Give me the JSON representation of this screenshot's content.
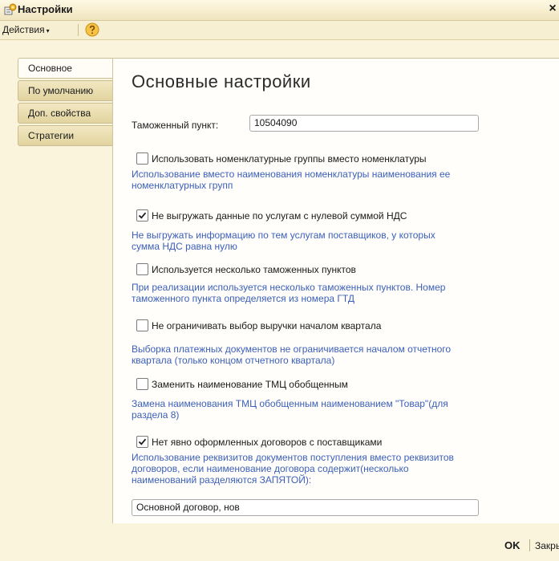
{
  "window": {
    "title": "Настройки",
    "close_symbol": "×"
  },
  "toolbar": {
    "actions_label": "Действия",
    "arrow": "▾"
  },
  "tabs": [
    {
      "label": "Основное"
    },
    {
      "label": "По умолчанию"
    },
    {
      "label": "Доп. свойства"
    },
    {
      "label": "Стратегии"
    }
  ],
  "main": {
    "heading": "Основные настройки",
    "customs_point": {
      "label": "Таможенный пункт:",
      "value": "10504090"
    },
    "options": [
      {
        "label": "Использовать номенклатурные группы вместо номенклатуры",
        "checked": false,
        "hint": "Использование вместо наименования номенклатуры наименования ее номенклатурных групп"
      },
      {
        "label": "Не выгружать данные по услугам с нулевой суммой НДС",
        "checked": true,
        "hint": "Не выгружать информацию по тем услугам поставщиков, у которых сумма НДС равна нулю"
      },
      {
        "label": "Используется несколько таможенных пунктов",
        "checked": false,
        "hint": "При  реализации используется несколько таможенных пунктов. Номер таможенного пункта определяется из номера ГТД"
      },
      {
        "label": "Не ограничивать выбор выручки началом квартала",
        "checked": false,
        "hint": "Выборка платежных документов не ограничивается началом отчетного квартала (только концом отчетного квартала)"
      },
      {
        "label": "Заменить наименование ТМЦ обобщенным",
        "checked": false,
        "hint": "Замена наименования ТМЦ обобщенным наименованием \"Товар\"(для раздела 8)"
      },
      {
        "label": "Нет явно оформленных договоров с поставщиками",
        "checked": true,
        "hint": "Использование реквизитов документов поступления вместо реквизитов договоров, если наименование договора содержит(несколько наименований разделяются ЗАПЯТОЙ):"
      }
    ],
    "contracts_value": "Основной договор, нов"
  },
  "footer": {
    "ok_label": "OK",
    "close_label": "Закрыть"
  },
  "colors": {
    "background": "#fbf4dc",
    "hint_text": "#3b5fb9",
    "panel": "#fffefb"
  }
}
